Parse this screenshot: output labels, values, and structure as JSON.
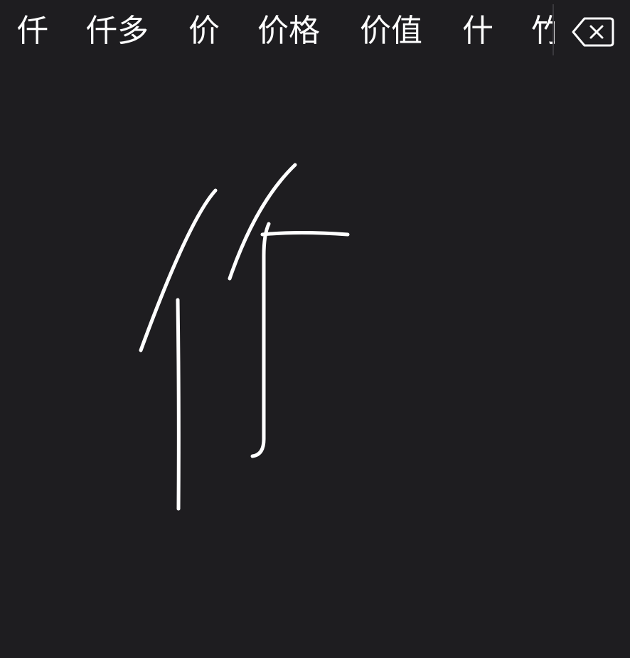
{
  "candidates": [
    {
      "label": "仟"
    },
    {
      "label": "仟多"
    },
    {
      "label": "价"
    },
    {
      "label": "价格"
    },
    {
      "label": "价值"
    },
    {
      "label": "什"
    },
    {
      "label": "竹"
    }
  ],
  "delete_key": {
    "icon": "backspace-icon"
  },
  "ink": {
    "color": "#ffffff",
    "background": "#1e1d20"
  }
}
